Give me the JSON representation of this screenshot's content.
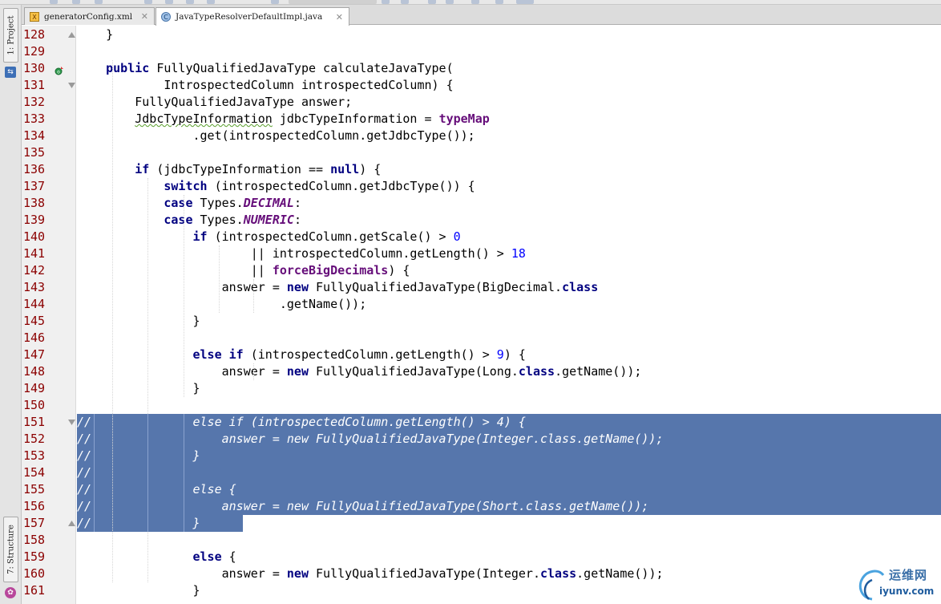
{
  "tabs": [
    {
      "label": "generatorConfig.xml",
      "icon": "xml-file-icon",
      "active": false
    },
    {
      "label": "JavaTypeResolverDefaultImpl.java",
      "icon": "java-class-icon",
      "active": true
    }
  ],
  "tool_windows": {
    "project": "1: Project",
    "structure": "7: Structure"
  },
  "editor": {
    "line_numbers": [
      "128",
      "129",
      "130",
      "131",
      "132",
      "133",
      "134",
      "135",
      "136",
      "137",
      "138",
      "139",
      "140",
      "141",
      "142",
      "143",
      "144",
      "145",
      "146",
      "147",
      "148",
      "149",
      "150",
      "151",
      "152",
      "153",
      "154",
      "155",
      "156",
      "157",
      "158",
      "159",
      "160",
      "161"
    ],
    "selected_lines": [
      "151",
      "152",
      "153",
      "154",
      "155",
      "156",
      "157"
    ],
    "caret_line": "151"
  },
  "watermark": {
    "brand": "运维网",
    "url": "iyunv.com"
  },
  "colors": {
    "keyword": "#000080",
    "field": "#660e7a",
    "number": "#0000ff",
    "line_number": "#8b0000",
    "selection": "#5676ac",
    "gutter_bg": "#f0f0f0"
  }
}
